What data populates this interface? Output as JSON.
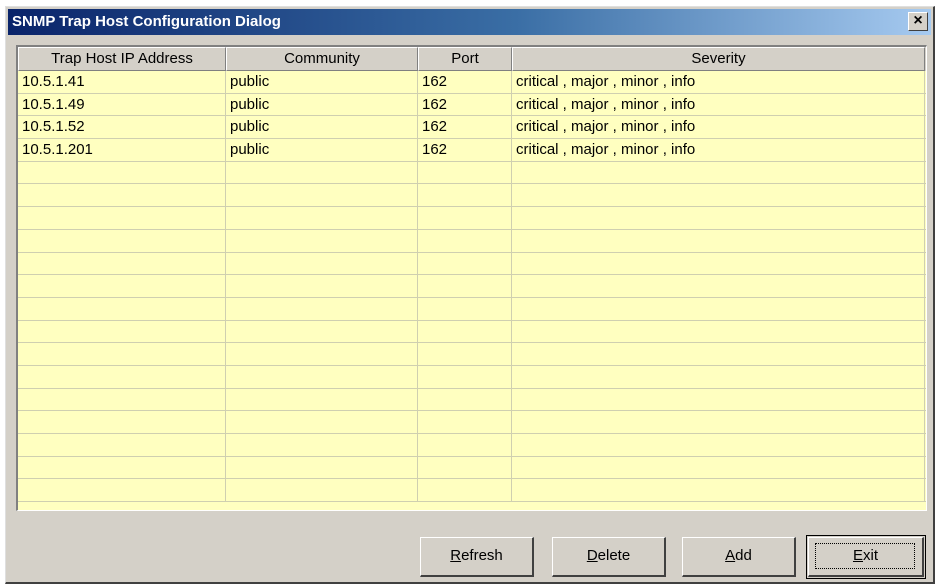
{
  "window": {
    "title": "SNMP Trap Host Configuration Dialog",
    "close_label": "×"
  },
  "table": {
    "columns": [
      "Trap Host IP Address",
      "Community",
      "Port",
      "Severity"
    ],
    "rows": [
      [
        "10.5.1.41",
        "public",
        "162",
        "critical , major , minor , info"
      ],
      [
        "10.5.1.49",
        "public",
        "162",
        "critical , major , minor , info"
      ],
      [
        "10.5.1.52",
        "public",
        "162",
        "critical , major , minor , info"
      ],
      [
        "10.5.1.201",
        "public",
        "162",
        "critical , major , minor , info"
      ]
    ],
    "empty_row_count": 15,
    "background_color": "#ffffc0"
  },
  "buttons": {
    "refresh": {
      "mnemonic": "R",
      "rest": "efresh"
    },
    "delete": {
      "mnemonic": "D",
      "rest": "elete"
    },
    "add": {
      "mnemonic": "A",
      "rest": "dd"
    },
    "exit": {
      "mnemonic": "E",
      "rest": "xit"
    }
  }
}
